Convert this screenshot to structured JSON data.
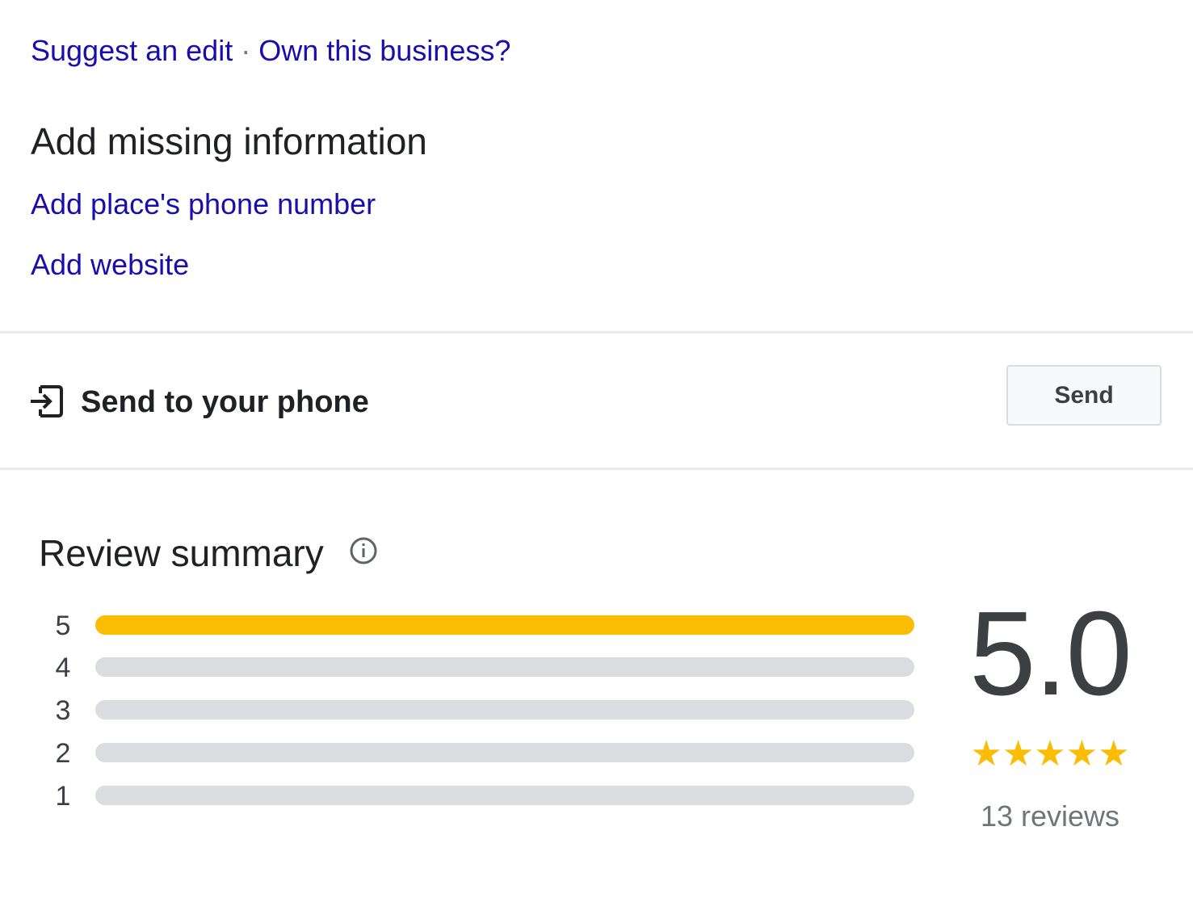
{
  "edit_links": {
    "suggest_edit": "Suggest an edit",
    "separator": "·",
    "own_business": "Own this business?"
  },
  "missing_info": {
    "title": "Add missing information",
    "links": [
      "Add place's phone number",
      "Add website"
    ]
  },
  "send_to_phone": {
    "icon": "send-to-device-icon",
    "label": "Send to your phone",
    "button_label": "Send"
  },
  "review_summary": {
    "title": "Review summary",
    "info_icon": "info-icon",
    "rating": "5.0",
    "stars_display": "★★★★★",
    "star_rating_value": 5,
    "reviews_count_label": "13 reviews",
    "bar_fill_color": "#fbbc04",
    "bar_track_color": "#dadce0",
    "distribution": [
      {
        "stars": "5",
        "fraction": 1.0
      },
      {
        "stars": "4",
        "fraction": 0.0
      },
      {
        "stars": "3",
        "fraction": 0.0
      },
      {
        "stars": "2",
        "fraction": 0.0
      },
      {
        "stars": "1",
        "fraction": 0.0
      }
    ]
  },
  "colors": {
    "link": "#1a0dab",
    "text_primary": "#202124",
    "text_secondary": "#70757a",
    "divider": "#e8eaed"
  }
}
